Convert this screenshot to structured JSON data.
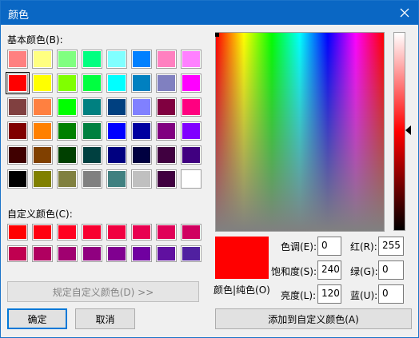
{
  "window": {
    "title": "颜色",
    "close_icon": "close-icon"
  },
  "basic_colors": {
    "label": "基本颜色(B):",
    "swatches": [
      "#ff8080",
      "#ffff80",
      "#80ff80",
      "#00ff80",
      "#80ffff",
      "#0080ff",
      "#ff80c0",
      "#ff80ff",
      "#ff0000",
      "#ffff00",
      "#80ff00",
      "#00ff40",
      "#00ffff",
      "#0080c0",
      "#8080c0",
      "#ff00ff",
      "#804040",
      "#ff8040",
      "#00ff00",
      "#008080",
      "#004080",
      "#8080ff",
      "#800040",
      "#ff0080",
      "#800000",
      "#ff8000",
      "#008000",
      "#008040",
      "#0000ff",
      "#0000a0",
      "#800080",
      "#8000ff",
      "#400000",
      "#804000",
      "#004000",
      "#004040",
      "#000080",
      "#000040",
      "#400040",
      "#400080",
      "#000000",
      "#808000",
      "#808040",
      "#808080",
      "#408080",
      "#c0c0c0",
      "#400040",
      "#ffffff"
    ],
    "selected_index": 8
  },
  "custom_colors": {
    "label": "自定义颜色(C):",
    "swatches": [
      "#ff0000",
      "#ff0010",
      "#ff0020",
      "#f80030",
      "#f00040",
      "#e80050",
      "#e00058",
      "#d00060",
      "#c00050",
      "#b00060",
      "#a00070",
      "#900080",
      "#800090",
      "#7000a0",
      "#6010a0",
      "#5020a0"
    ]
  },
  "buttons": {
    "define_custom": "规定自定义颜色(D) >>",
    "ok": "确定",
    "cancel": "取消",
    "add_custom": "添加到自定义颜色(A)"
  },
  "preview": {
    "label": "颜色|纯色(O)",
    "color": "#ff0000"
  },
  "hsl": {
    "hue_label": "色调(E):",
    "hue": "0",
    "sat_label": "饱和度(S):",
    "sat": "240",
    "lum_label": "亮度(L):",
    "lum": "120"
  },
  "rgb": {
    "red_label": "红(R):",
    "red": "255",
    "green_label": "绿(G):",
    "green": "0",
    "blue_label": "蓝(U):",
    "blue": "0"
  }
}
